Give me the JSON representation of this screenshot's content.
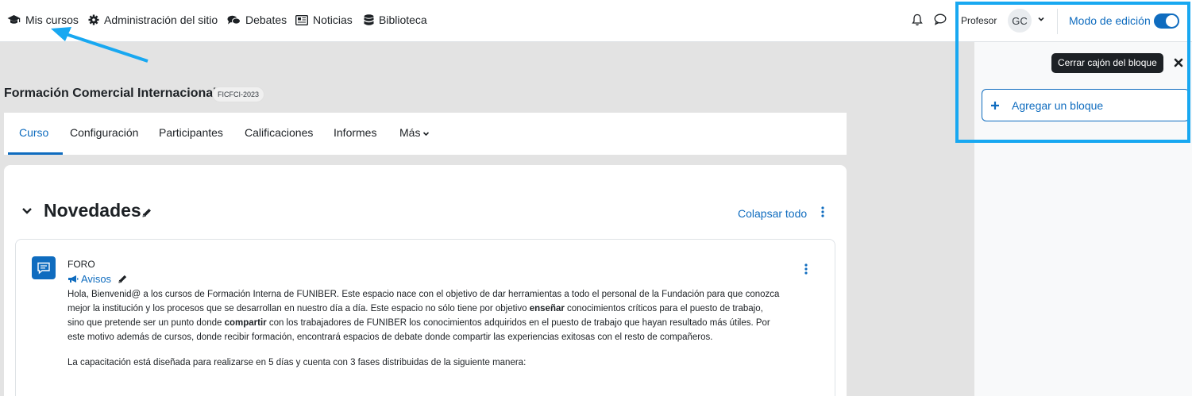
{
  "navbar": {
    "items": [
      {
        "label": "Mis cursos",
        "icon": "graduation-cap-icon"
      },
      {
        "label": "Administración del sitio",
        "icon": "gear-icon"
      },
      {
        "label": "Debates",
        "icon": "comments-icon"
      },
      {
        "label": "Noticias",
        "icon": "newspaper-icon"
      },
      {
        "label": "Biblioteca",
        "icon": "database-icon"
      }
    ],
    "role": "Profesor",
    "avatar_initials": "GC",
    "edit_mode_label": "Modo de edición",
    "edit_mode_on": true
  },
  "course": {
    "title": "Formación Comercial Internacional",
    "short_code": "FICFCI-2023"
  },
  "tabs": [
    {
      "label": "Curso",
      "active": true
    },
    {
      "label": "Configuración"
    },
    {
      "label": "Participantes"
    },
    {
      "label": "Calificaciones"
    },
    {
      "label": "Informes"
    },
    {
      "label": "Más"
    }
  ],
  "section": {
    "title": "Novedades",
    "collapse_all": "Colapsar todo"
  },
  "activity": {
    "type": "FORO",
    "name": "Avisos",
    "paragraph1_parts": [
      "Hola, Bienvenid@ a los cursos de Formación Interna de FUNIBER. Este espacio nace con el objetivo de dar herramientas a todo el personal de la Fundación para que conozca mejor la institución y los procesos que se desarrollan en nuestro día a día. Este espacio no sólo tiene por objetivo ",
      "enseñar",
      " conocimientos críticos para el puesto de trabajo, sino que pretende ser un punto donde ",
      "compartir",
      " con los trabajadores de FUNIBER los conocimientos adquiridos en el puesto de trabajo que hayan resultado más útiles. Por este motivo además de cursos, donde recibir formación, encontrará espacios de debate donde compartir las experiencias exitosas con el resto de compañeros."
    ],
    "paragraph2": "La capacitación está diseñada para realizarse en 5 días y cuenta con 3 fases distribuidas de la siguiente manera:"
  },
  "drawer": {
    "tooltip": "Cerrar cajón del bloque",
    "add_block_label": "Agregar un bloque"
  },
  "colors": {
    "accent": "#0f6cbf",
    "annotation": "#18a8f1"
  }
}
